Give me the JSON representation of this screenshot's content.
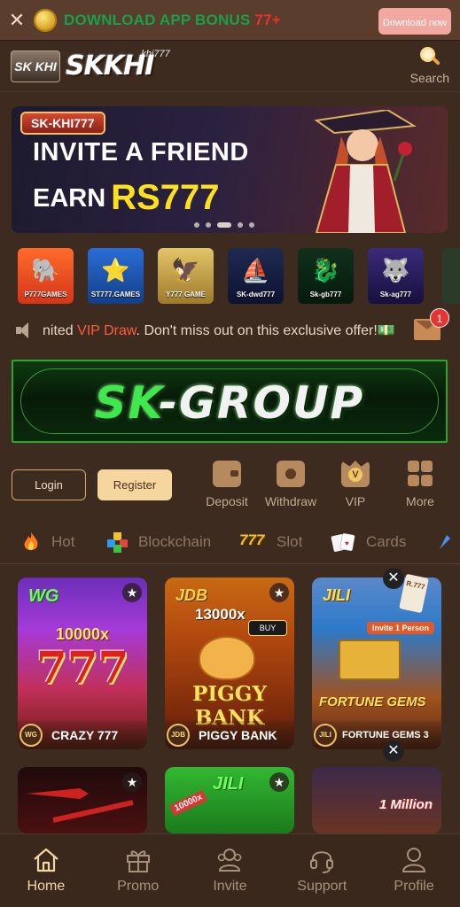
{
  "download_bar": {
    "text": "DOWNLOAD APP BONUS ",
    "bonus": "77+",
    "button_label": "Download now"
  },
  "header": {
    "logo_badge": "SK KHI",
    "logo_text": "SKKHI",
    "logo_sup": "khi777",
    "search_label": "Search"
  },
  "banner": {
    "tag": "SK-KHI777",
    "line1": "INVITE A FRIEND",
    "line2_prefix": "EARN",
    "line2_amount": "RS777",
    "slide_count": 5,
    "active_slide": 3
  },
  "partners": [
    {
      "label": "P777GAMES",
      "icon": "elephant-icon"
    },
    {
      "label": "ST777.GAMES",
      "icon": "star-icon"
    },
    {
      "label": "Y777 GAME",
      "icon": "eagle-icon"
    },
    {
      "label": "SK-dwd777",
      "icon": "ship-icon"
    },
    {
      "label": "Sk-gb777",
      "icon": "dragon-icon"
    },
    {
      "label": "Sk-ag777",
      "icon": "wolf-icon"
    }
  ],
  "marquee": {
    "prefix": "nited ",
    "highlight": "VIP Draw",
    "suffix": ". Don't miss out on this exclusive offer!💵",
    "mail_badge": "1"
  },
  "sk_group": {
    "text_sk": "SK",
    "text_rest": "-GROUP"
  },
  "auth": {
    "login": "Login",
    "register": "Register"
  },
  "quick_actions": [
    {
      "label": "Deposit",
      "icon": "wallet-icon"
    },
    {
      "label": "Withdraw",
      "icon": "ticket-icon"
    },
    {
      "label": "VIP",
      "icon": "vip-crown-icon",
      "glyph": "V"
    },
    {
      "label": "More",
      "icon": "grid-icon"
    }
  ],
  "categories": [
    {
      "label": "Hot",
      "icon": "fire-icon"
    },
    {
      "label": "Blockchain",
      "icon": "blocks-icon"
    },
    {
      "label": "Slot",
      "icon": "777-icon",
      "glyph": "777"
    },
    {
      "label": "Cards",
      "icon": "cards-icon"
    }
  ],
  "games": [
    {
      "provider": "WG",
      "name": "CRAZY 777",
      "chip": "WG",
      "multiplier": "10000x",
      "art": "777"
    },
    {
      "provider": "JDB",
      "name": "PIGGY BANK",
      "chip": "JDB",
      "multiplier": "13000x",
      "art": "PIGGY BANK",
      "buy": "BUY"
    },
    {
      "provider": "JILI",
      "name": "FORTUNE GEMS 3",
      "chip": "JILI",
      "art": "FORTUNE GEMS",
      "invite": "Invite 1 Person"
    },
    {
      "provider": "",
      "name": ""
    },
    {
      "provider": "JILI",
      "name": "",
      "multiplier": "10000x"
    },
    {
      "provider": "",
      "name": ""
    }
  ],
  "ads": {
    "ticket_text": "R.777",
    "million_text": "1 Million"
  },
  "bottom_nav": [
    {
      "label": "Home",
      "icon": "home-icon",
      "active": true
    },
    {
      "label": "Promo",
      "icon": "gift-icon"
    },
    {
      "label": "Invite",
      "icon": "people-icon"
    },
    {
      "label": "Support",
      "icon": "headset-icon"
    },
    {
      "label": "Profile",
      "icon": "user-icon"
    }
  ],
  "colors": {
    "background": "#3d2b20",
    "accent_gold": "#f5d69e",
    "bonus_green": "#16a14a",
    "highlight_red": "#ff5c3a"
  }
}
